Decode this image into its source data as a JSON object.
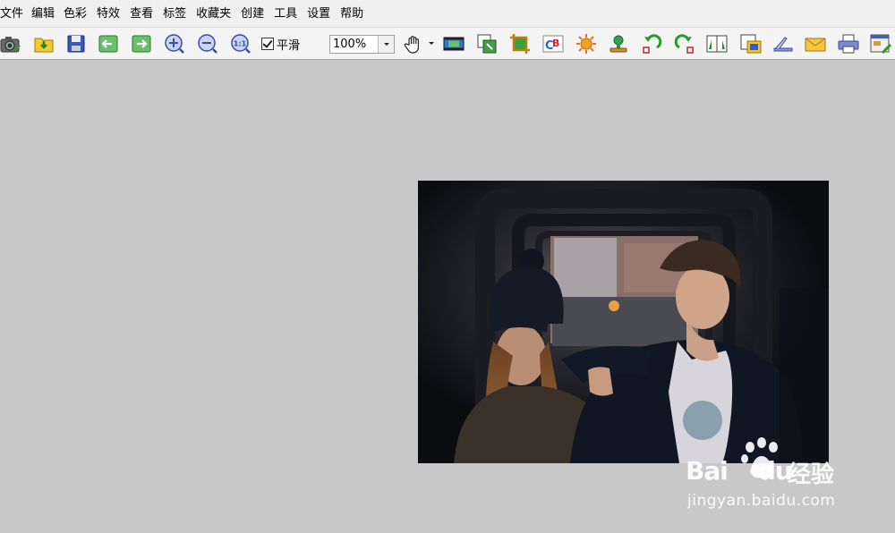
{
  "menu": [
    "文件",
    "编辑",
    "色彩",
    "特效",
    "查看",
    "标签",
    "收藏夹",
    "创建",
    "工具",
    "设置",
    "帮助"
  ],
  "toolbar": {
    "smooth_label": "平滑",
    "smooth_checked": true,
    "zoom_value": "100%",
    "buttons": [
      "camera-icon",
      "open-folder-icon",
      "save-icon",
      "previous-icon",
      "next-icon",
      "zoom-in-icon",
      "zoom-out-icon",
      "actual-size-icon",
      "hand-tool-icon",
      "slideshow-icon",
      "resize-icon",
      "crop-icon",
      "color-balance-icon",
      "brightness-icon",
      "stamp-icon",
      "rotate-left-icon",
      "rotate-right-icon",
      "flip-icon",
      "frame-icon",
      "scan-icon",
      "email-icon",
      "print-icon",
      "edit-icon"
    ]
  },
  "image": {
    "description_name": "couple-photo"
  },
  "watermark": {
    "logo": "Bai",
    "logo2": "du",
    "cn": "经验",
    "url": "jingyan.baidu.com"
  }
}
